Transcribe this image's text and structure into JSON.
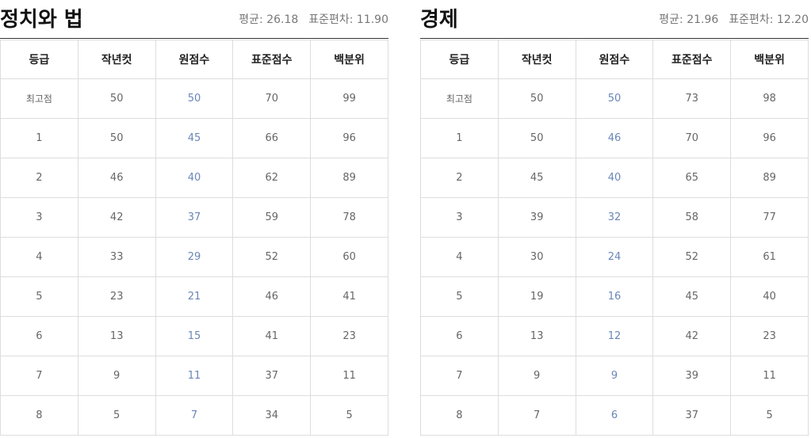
{
  "accent_color": "#6a86b8",
  "headers": [
    "등급",
    "작년컷",
    "원점수",
    "표준점수",
    "백분위"
  ],
  "subjects": [
    {
      "id": "politics",
      "title": "정치와 법",
      "mean_label": "평균:",
      "mean": "26.18",
      "sd_label": "표준편차:",
      "sd": "11.90",
      "rows": [
        [
          "최고점",
          "50",
          "50",
          "70",
          "99"
        ],
        [
          "1",
          "50",
          "45",
          "66",
          "96"
        ],
        [
          "2",
          "46",
          "40",
          "62",
          "89"
        ],
        [
          "3",
          "42",
          "37",
          "59",
          "78"
        ],
        [
          "4",
          "33",
          "29",
          "52",
          "60"
        ],
        [
          "5",
          "23",
          "21",
          "46",
          "41"
        ],
        [
          "6",
          "13",
          "15",
          "41",
          "23"
        ],
        [
          "7",
          "9",
          "11",
          "37",
          "11"
        ],
        [
          "8",
          "5",
          "7",
          "34",
          "5"
        ]
      ]
    },
    {
      "id": "economy",
      "title": "경제",
      "mean_label": "평균:",
      "mean": "21.96",
      "sd_label": "표준편차:",
      "sd": "12.20",
      "rows": [
        [
          "최고점",
          "50",
          "50",
          "73",
          "98"
        ],
        [
          "1",
          "50",
          "46",
          "70",
          "96"
        ],
        [
          "2",
          "45",
          "40",
          "65",
          "89"
        ],
        [
          "3",
          "39",
          "32",
          "58",
          "77"
        ],
        [
          "4",
          "30",
          "24",
          "52",
          "61"
        ],
        [
          "5",
          "19",
          "16",
          "45",
          "40"
        ],
        [
          "6",
          "13",
          "12",
          "42",
          "23"
        ],
        [
          "7",
          "9",
          "9",
          "39",
          "11"
        ],
        [
          "8",
          "7",
          "6",
          "37",
          "5"
        ]
      ]
    }
  ]
}
